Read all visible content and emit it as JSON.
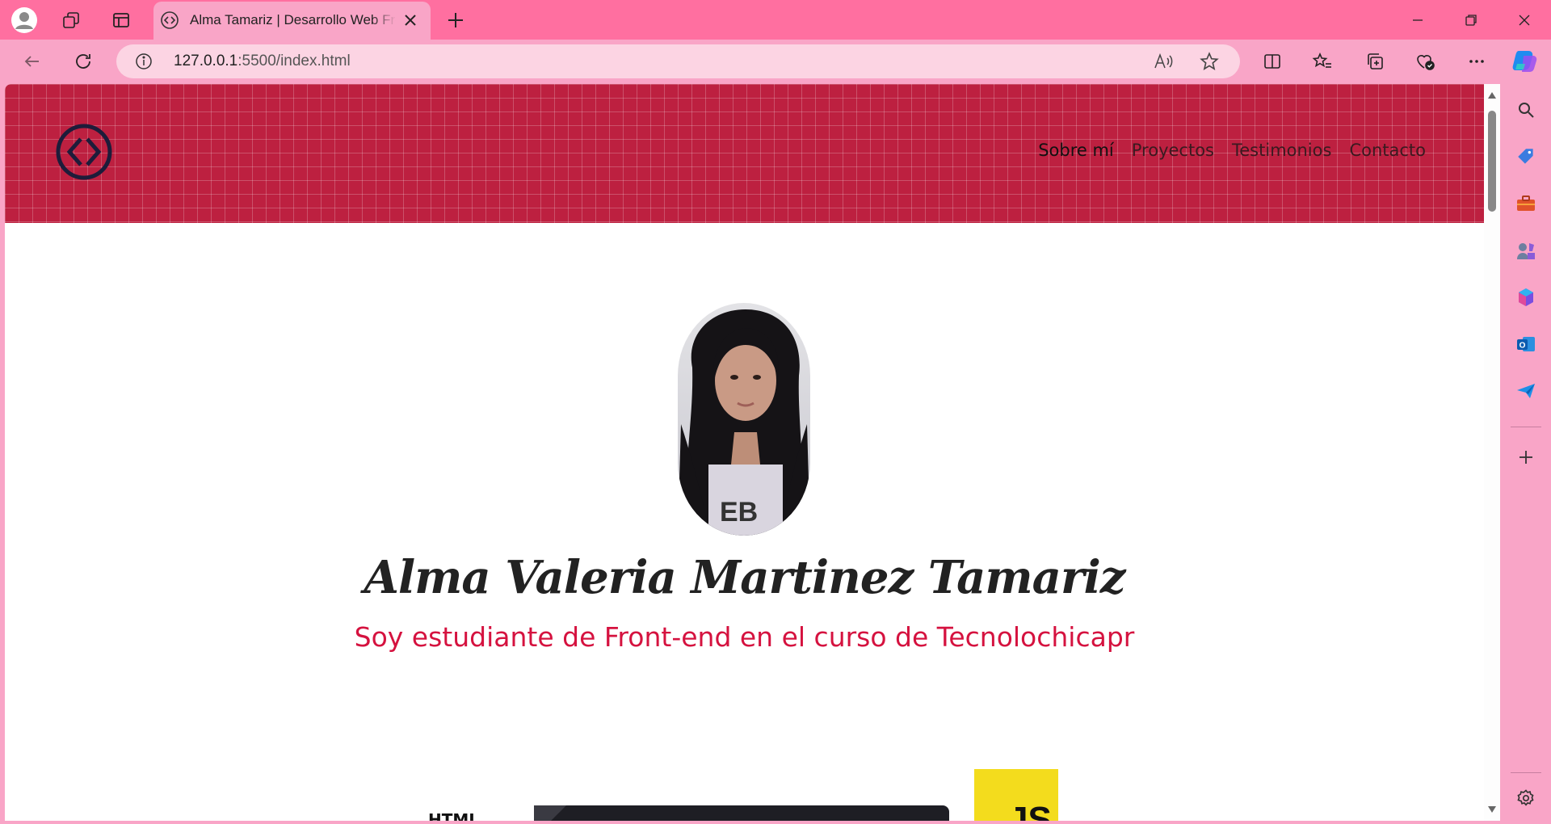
{
  "browser": {
    "tab_title": "Alma Tamariz | Desarrollo Web Front-end",
    "url_host": "127.0.0.1",
    "url_rest": ":5500/index.html",
    "new_tab_label": "+"
  },
  "nav": {
    "items": [
      "Sobre mí",
      "Proyectos",
      "Testimonios",
      "Contacto"
    ]
  },
  "hero": {
    "name": "Alma Valeria Martinez Tamariz",
    "subtitle": "Soy estudiante de Front-end en el curso de Tecnolochicapr"
  },
  "skills": {
    "html_label": "HTML",
    "js_label": "JS"
  },
  "colors": {
    "chrome_tab_bar": "#ff6fa0",
    "chrome_toolbar": "#f9a5c7",
    "header_red": "#bd2040",
    "subtitle_red": "#d5123f",
    "js_yellow": "#f3dc1d"
  }
}
